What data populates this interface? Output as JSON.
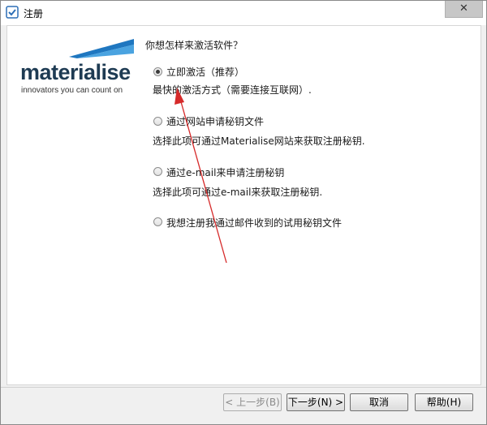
{
  "window": {
    "title": "注册",
    "close_glyph": "✕",
    "app_icon": "registration-app-icon"
  },
  "logo": {
    "wordmark": "materialise",
    "tagline": "innovators you can count on",
    "brand_color": "#1e3b53",
    "accent_color": "#1f77c0"
  },
  "main": {
    "question": "你想怎样来激活软件？",
    "options": [
      {
        "label": "立即激活（推荐）",
        "description": "最快的激活方式（需要连接互联网）.",
        "selected": true
      },
      {
        "label": "通过网站申请秘钥文件",
        "description": "选择此项可通过Materialise网站来获取注册秘钥.",
        "selected": false
      },
      {
        "label": "通过e-mail来申请注册秘钥",
        "description": "选择此项可通过e-mail来获取注册秘钥.",
        "selected": false
      },
      {
        "label": "我想注册我通过邮件收到的试用秘钥文件",
        "description": "",
        "selected": false
      }
    ],
    "annotation_color": "#d62a2a"
  },
  "buttons": {
    "back": "< 上一步(B)",
    "next": "下一步(N) >",
    "cancel": "取消",
    "help": "帮助(H)"
  }
}
